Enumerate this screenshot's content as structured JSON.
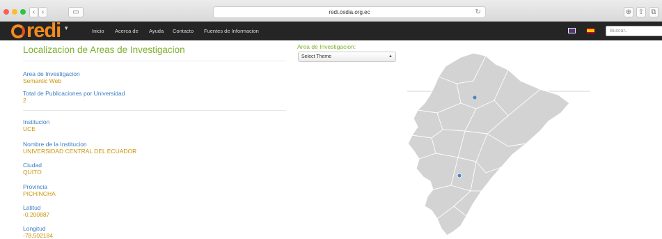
{
  "browser": {
    "url": "redi.cedia.org.ec",
    "back": "‹",
    "forward": "›"
  },
  "navbar": {
    "logo_text": "redi",
    "links": [
      "Inicio",
      "Acerca de",
      "Ayuda",
      "Contacto",
      "Fuentes de Informacion"
    ],
    "search_placeholder": "Buscar.."
  },
  "page": {
    "title": "Localizacion de Areas de Investigacion",
    "select_label": "Area de Investigacion:",
    "select_value": "Select Theme"
  },
  "fields": [
    {
      "label": "Area de Investigacion",
      "value": "Semantic Web"
    },
    {
      "label": "Total de Publicaciones por Universidad",
      "value": "2"
    },
    {
      "label": "Institucion",
      "value": "UCE"
    },
    {
      "label": "Nombre de la Institucion",
      "value": "UNIVERSIDAD CENTRAL DEL ECUADOR"
    },
    {
      "label": "Ciudad",
      "value": "QUITO"
    },
    {
      "label": "Provincia",
      "value": "PICHINCHA"
    },
    {
      "label": "Latitud",
      "value": "-0.200887"
    },
    {
      "label": "Longitud",
      "value": "-78.502184"
    }
  ],
  "colors": {
    "accent_green": "#7bb02c",
    "label_blue": "#3a7cc4",
    "value_gold": "#c8960a",
    "marker": "#4a86c9"
  }
}
